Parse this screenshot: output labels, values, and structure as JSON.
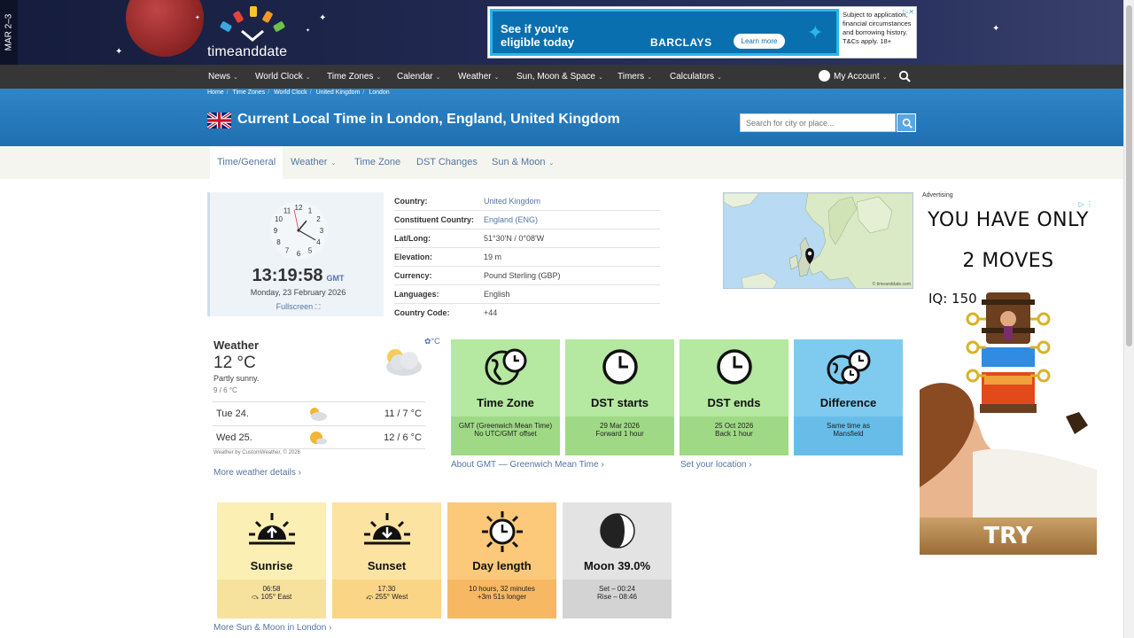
{
  "header": {
    "date_tab": "MAR 2–3",
    "logo_text": "timeanddate",
    "ad": {
      "headline": "See if you're eligible today",
      "brand": "BARCLAYS",
      "cta": "Learn more",
      "small_print": "Subject to application, financial circumstances and borrowing history. T&Cs apply. 18+"
    }
  },
  "nav": {
    "items": [
      "News",
      "World Clock",
      "Time Zones",
      "Calendar",
      "Weather",
      "Sun, Moon & Space",
      "Timers",
      "Calculators"
    ],
    "account": "My Account"
  },
  "breadcrumb": [
    "Home",
    "Time Zones",
    "World Clock",
    "United Kingdom",
    "London"
  ],
  "page": {
    "title": "Current Local Time in London, England, United Kingdom",
    "search_placeholder": "Search for city or place..."
  },
  "tabs": [
    {
      "label": "Time/General",
      "active": true
    },
    {
      "label": "Weather",
      "dropdown": true
    },
    {
      "label": "Time Zone"
    },
    {
      "label": "DST Changes"
    },
    {
      "label": "Sun & Moon",
      "dropdown": true
    }
  ],
  "clock": {
    "time": "13:19:58",
    "tz": "GMT",
    "date": "Monday, 23 February 2026",
    "fullscreen": "Fullscreen",
    "numerals": [
      "12",
      "1",
      "2",
      "3",
      "4",
      "5",
      "6",
      "7",
      "8",
      "9",
      "10",
      "11"
    ]
  },
  "info": [
    {
      "key": "Country:",
      "value": "United Kingdom",
      "link": true
    },
    {
      "key": "Constituent Country:",
      "value": "England (ENG)",
      "link": true
    },
    {
      "key": "Lat/Long:",
      "value": "51°30'N / 0°08'W"
    },
    {
      "key": "Elevation:",
      "value": "19 m"
    },
    {
      "key": "Currency:",
      "value": "Pound Sterling (GBP)"
    },
    {
      "key": "Languages:",
      "value": "English"
    },
    {
      "key": "Country Code:",
      "value": "+44"
    }
  ],
  "map": {
    "credit": "© timeanddate.com"
  },
  "weather": {
    "title": "Weather",
    "temp": "12 °C",
    "desc": "Partly sunny.",
    "range": "9 / 6 °C",
    "unit_toggle": "°C",
    "forecast": [
      {
        "day": "Tue 24.",
        "temp": "11 / 7 °C"
      },
      {
        "day": "Wed 25.",
        "temp": "12 / 6 °C"
      }
    ],
    "credit": "Weather by CustomWeather, © 2026",
    "more": "More weather details"
  },
  "cards": [
    {
      "title": "Time Zone",
      "sub1": "GMT (Greenwich Mean Time)",
      "sub2": "No UTC/GMT offset"
    },
    {
      "title": "DST starts",
      "sub1": "29 Mar 2026",
      "sub2": "Forward 1 hour"
    },
    {
      "title": "DST ends",
      "sub1": "25 Oct 2026",
      "sub2": "Back 1 hour"
    },
    {
      "title": "Difference",
      "sub1": "Same time as",
      "sub2": "Mansfield"
    }
  ],
  "card_links": {
    "gmt": "About GMT — Greenwich Mean Time",
    "location": "Set your location"
  },
  "sun_cards": [
    {
      "title": "Sunrise",
      "sub1": "06:58",
      "sub2": "105° East"
    },
    {
      "title": "Sunset",
      "sub1": "17:30",
      "sub2": "255° West"
    },
    {
      "title": "Day length",
      "sub1": "10 hours, 32 minutes",
      "sub2": "+3m 51s longer"
    },
    {
      "title": "Moon 39.0%",
      "sub1": "Set – 00:24",
      "sub2": "Rise – 08:46"
    }
  ],
  "sun_more": "More Sun & Moon in London",
  "ad_right": {
    "label": "Advertising",
    "line1": "YOU HAVE ONLY",
    "line2": "2 MOVES",
    "iq": "IQ: 150",
    "cta": "TRY"
  },
  "colors": {
    "nav_bg": "#363636",
    "band_bg": "#1f6fb1",
    "link": "#5575a3",
    "green_card": "#b5e8a0",
    "blue_card": "#7fcbf0"
  }
}
